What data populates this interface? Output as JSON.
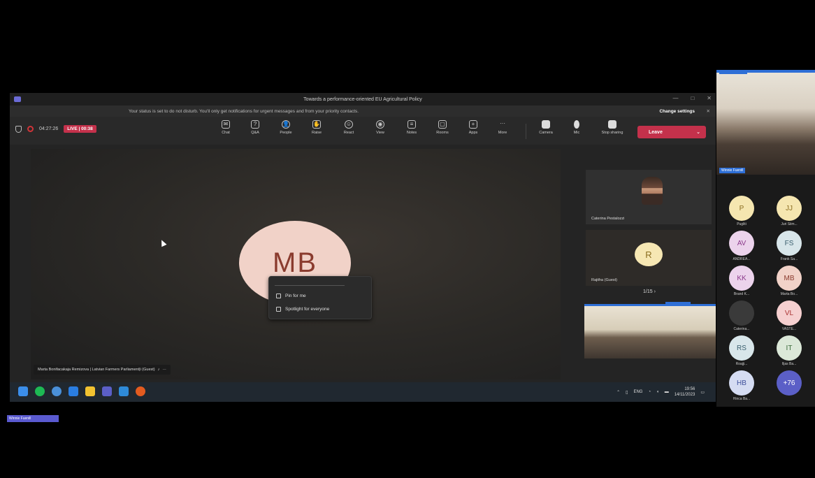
{
  "window": {
    "title": "Towards a performance-oriented EU Agricultural Policy",
    "min": "—",
    "max": "□",
    "close": "✕"
  },
  "notice": {
    "message": "Your status is set to do not disturb. You'll only get notifications for urgent messages and from your priority contacts.",
    "action": "Change settings",
    "dismiss": "✕"
  },
  "toolbar": {
    "timer": "04:27:26",
    "live": "LIVE | 00:38",
    "buttons": [
      {
        "label": "Chat",
        "icon": "chat-icon",
        "glyph": "✉"
      },
      {
        "label": "Q&A",
        "icon": "qa-icon",
        "glyph": "?"
      },
      {
        "label": "People",
        "icon": "people-icon",
        "glyph": "👤"
      },
      {
        "label": "Raise",
        "icon": "raise-hand-icon",
        "glyph": "✋"
      },
      {
        "label": "React",
        "icon": "react-icon",
        "glyph": "☺"
      },
      {
        "label": "View",
        "icon": "view-icon",
        "glyph": "◉"
      },
      {
        "label": "Notes",
        "icon": "notes-icon",
        "glyph": "≡"
      },
      {
        "label": "Rooms",
        "icon": "rooms-icon",
        "glyph": "▢"
      },
      {
        "label": "Apps",
        "icon": "apps-icon",
        "glyph": "+"
      },
      {
        "label": "More",
        "icon": "more-icon",
        "glyph": "···"
      }
    ],
    "media": [
      {
        "label": "Camera",
        "icon": "camera-icon",
        "glyph": "▮"
      },
      {
        "label": "Mic",
        "icon": "mic-icon",
        "glyph": "●"
      },
      {
        "label": "Stop sharing",
        "icon": "share-icon",
        "glyph": "■"
      }
    ],
    "leave": "Leave",
    "leave_chevron": "⌄"
  },
  "stage": {
    "initials": "MB",
    "name_tag": "Marta Bonifacakaja Remizova | Latvian Farmers Parliament|i (Guest)",
    "menu": {
      "pin": "Pin for me",
      "spotlight": "Spotlight for everyone"
    }
  },
  "side_tiles": {
    "cat_label": "Caterina Pestalozzi",
    "r_initial": "R",
    "r_label": "Rajitha (Guest)",
    "pager": "1/15 ›"
  },
  "taskbar": {
    "lang": "ENG",
    "time": "19:56",
    "date": "14/11/2023"
  },
  "bottom_badge": "Winnie Fuenill",
  "right_col": {
    "cam_label": "Winnie Fuenill",
    "participants": [
      {
        "initials": "P",
        "name": "Pugliti",
        "bg": "#f5e6b0",
        "fg": "#8a6d20"
      },
      {
        "initials": "JJ",
        "name": "Juri Siim...",
        "bg": "#f5e6b0",
        "fg": "#8a6d20"
      },
      {
        "initials": "AV",
        "name": "ANDREA...",
        "bg": "#ecd3ec",
        "fg": "#8b3a8b"
      },
      {
        "initials": "FS",
        "name": "Frank Sa...",
        "bg": "#d8e6ea",
        "fg": "#3a5f6e"
      },
      {
        "initials": "KK",
        "name": "Brand K...",
        "bg": "#ecd3ec",
        "fg": "#8b3a8b"
      },
      {
        "initials": "MB",
        "name": "Marta Bo...",
        "bg": "#f1d2c8",
        "fg": "#8a3b2e"
      },
      {
        "initials": "",
        "name": "Caterina...",
        "bg": "#3a3a3a",
        "fg": "#ccc"
      },
      {
        "initials": "VL",
        "name": "VASTE...",
        "bg": "#f6d0d0",
        "fg": "#a33"
      },
      {
        "initials": "RS",
        "name": "Roajji...",
        "bg": "#d8e6ea",
        "fg": "#3a5f6e"
      },
      {
        "initials": "IT",
        "name": "Iljas Ba...",
        "bg": "#dbe8d8",
        "fg": "#3b6b3b"
      },
      {
        "initials": "HB",
        "name": "Hinca Ba...",
        "bg": "#d5dcf2",
        "fg": "#3e4f9a"
      },
      {
        "initials": "+76",
        "name": "",
        "bg": "#5b5fc7",
        "fg": "#fff"
      }
    ]
  }
}
